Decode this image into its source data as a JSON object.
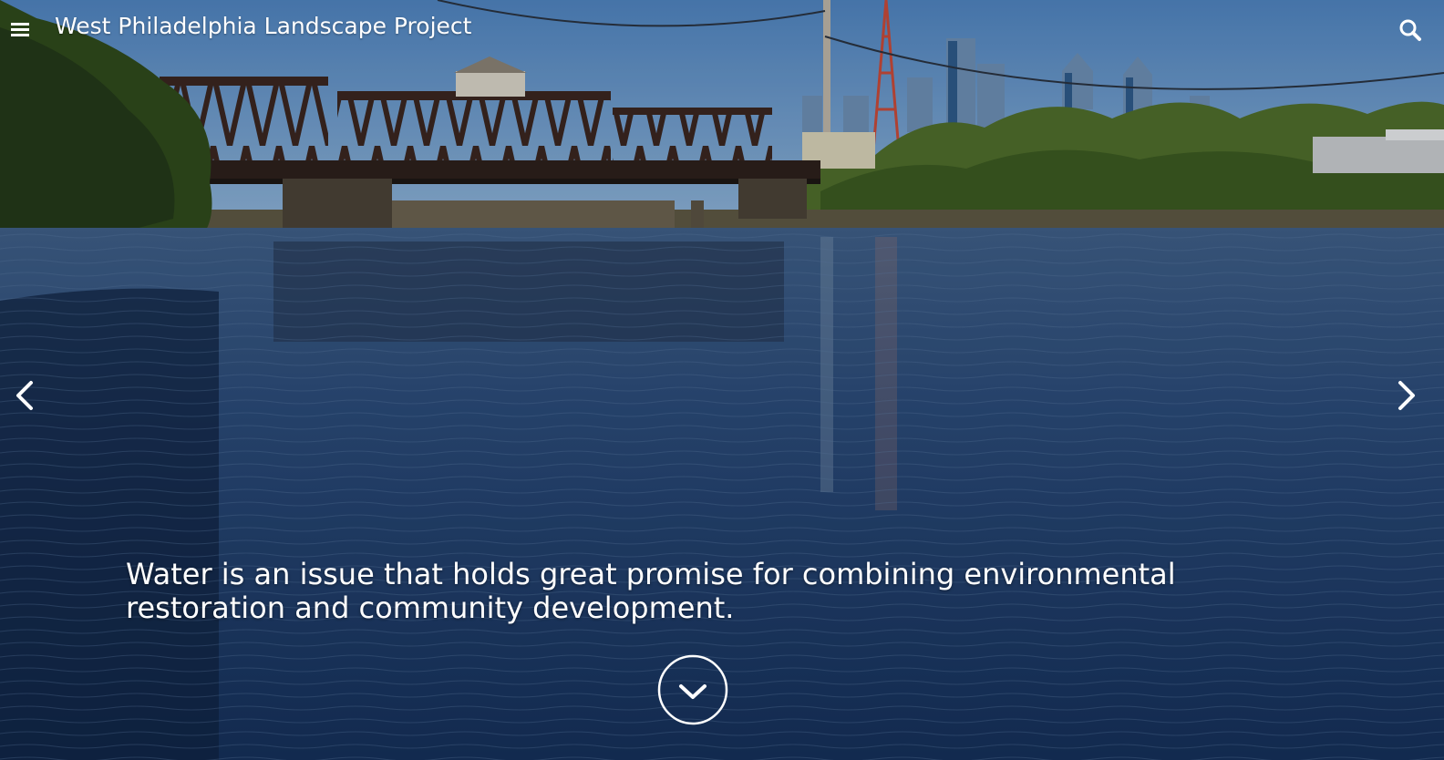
{
  "header": {
    "site_title": "West Philadelphia Landscape Project",
    "menu_icon": "hamburger-menu-icon",
    "search_icon": "search-icon"
  },
  "hero": {
    "caption": "Water is an issue that holds great promise for combining environmental restoration and community development.",
    "prev_icon": "chevron-left-icon",
    "next_icon": "chevron-right-icon",
    "scroll_icon": "chevron-down-circle-icon"
  },
  "colors": {
    "text": "#ffffff",
    "sky": "#5a8cc4",
    "water": "#1f3d6b",
    "bridge": "#3a2a24",
    "trees": "#4a6b2a"
  }
}
